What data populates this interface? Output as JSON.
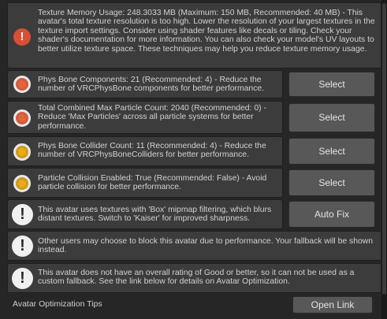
{
  "messages": [
    {
      "text": "Texture Memory Usage: 248.3033 MB (Maximum: 150 MB, Recommended: 40 MB) - This avatar's total texture resolution is too high. Lower the resolution of your largest textures in the texture import settings. Consider using shader features like decals or tiling. Check your shader's documentation for more information. You can also check your model's UV layouts to better utilize texture space. These techniques may help you reduce texture memory usage."
    },
    {
      "text": "Phys Bone Components: 21 (Recommended: 4) - Reduce the number of VRCPhysBone components for better performance.",
      "button": "Select"
    },
    {
      "text": "Total Combined Max Particle Count: 2040 (Recommended: 0) - Reduce 'Max Particles' across all particle systems for better performance.",
      "button": "Select"
    },
    {
      "text": "Phys Bone Collider Count: 11 (Recommended: 4) - Reduce the number of VRCPhysBoneColliders for better performance.",
      "button": "Select"
    },
    {
      "text": "Particle Collision Enabled: True (Recommended: False) - Avoid particle collision for better performance.",
      "button": "Select"
    },
    {
      "text": "This avatar uses textures with 'Box' mipmap filtering, which blurs distant textures. Switch to 'Kaiser' for improved sharpness.",
      "button": "Auto Fix"
    },
    {
      "text": "Other users may choose to block this avatar due to performance. Your fallback will be shown instead."
    },
    {
      "text": "This avatar does not have an overall rating of Good or better, so it can not be used as a custom fallback. See the link below for details on Avatar Optimization."
    }
  ],
  "footer": {
    "label": "Avatar Optimization Tips",
    "button": "Open Link"
  },
  "colors": {
    "error_red": "#d94f33",
    "poor_red": "#d35a3a",
    "medium_yellow": "#cf9a18",
    "info_white": "#f0f0f0",
    "panel_bg": "#262626",
    "box_bg": "#3c3c3c",
    "button_bg": "#585858"
  },
  "icons": {
    "texture_memory": "exclamation-circle-red-icon",
    "poor": "red-circle-icon",
    "medium": "yellow-circle-icon",
    "info": "info-exclamation-icon"
  }
}
